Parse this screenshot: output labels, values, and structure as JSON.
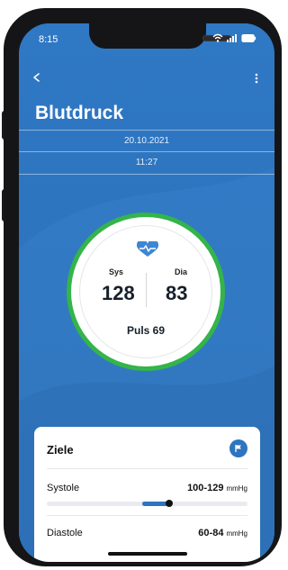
{
  "status_bar": {
    "time": "8:15"
  },
  "header": {
    "title": "Blutdruck"
  },
  "meta": {
    "date": "20.10.2021",
    "time": "11:27"
  },
  "reading": {
    "sys_label": "Sys",
    "dia_label": "Dia",
    "sys_value": "128",
    "dia_value": "83",
    "pulse_text": "Puls 69",
    "ring_color": "#34b44a"
  },
  "goals": {
    "title": "Ziele",
    "systole": {
      "label": "Systole",
      "range": "100-129",
      "unit": "mmHg",
      "marker_value": 128
    },
    "diastole": {
      "label": "Diastole",
      "range": "60-84",
      "unit": "mmHg"
    }
  },
  "colors": {
    "accent": "#2e74bf",
    "ok": "#34b44a"
  },
  "icons": [
    "back-arrow-icon",
    "more-vert-icon",
    "heart-icon",
    "flag-icon",
    "wifi-icon",
    "signal-icon",
    "battery-icon"
  ]
}
